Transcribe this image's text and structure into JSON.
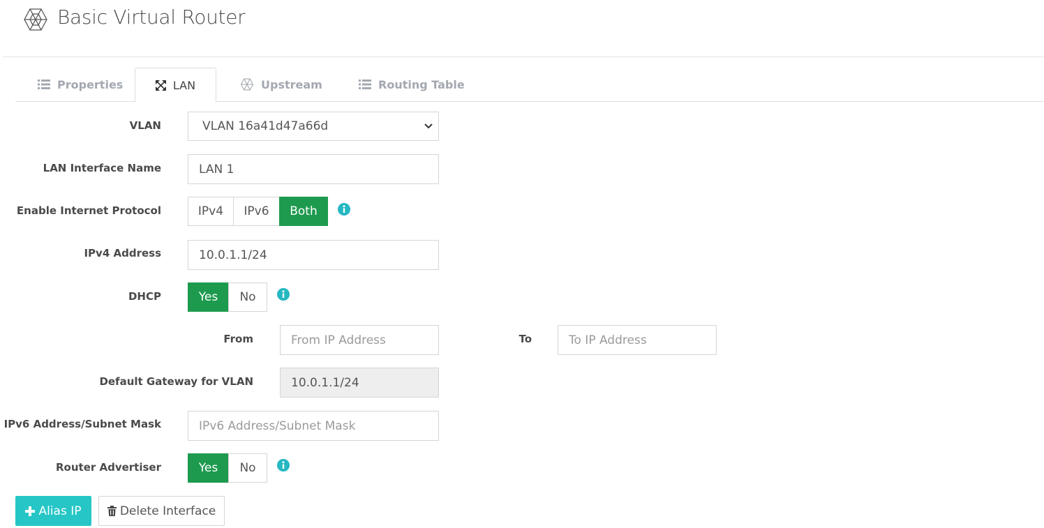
{
  "header": {
    "title": "Basic Virtual Router",
    "logo_icon": "hexagon-mesh-icon"
  },
  "tabs": [
    {
      "label": "Properties",
      "icon": "list-icon",
      "active": false
    },
    {
      "label": "LAN",
      "icon": "expand-arrows-icon",
      "active": true
    },
    {
      "label": "Upstream",
      "icon": "hexagon-mesh-icon",
      "active": false
    },
    {
      "label": "Routing Table",
      "icon": "list-icon",
      "active": false
    }
  ],
  "form": {
    "vlan": {
      "label": "VLAN",
      "value": "VLAN 16a41d47a66d"
    },
    "lan_name": {
      "label": "LAN Interface Name",
      "value": "LAN 1"
    },
    "protocol": {
      "label": "Enable Internet Protocol",
      "options": [
        "IPv4",
        "IPv6",
        "Both"
      ],
      "selected": "Both"
    },
    "ipv4": {
      "label": "IPv4 Address",
      "value": "10.0.1.1/24"
    },
    "dhcp": {
      "label": "DHCP",
      "options": [
        "Yes",
        "No"
      ],
      "selected": "Yes"
    },
    "from": {
      "label": "From",
      "placeholder": "From IP Address"
    },
    "to": {
      "label": "To",
      "placeholder": "To IP Address"
    },
    "gateway": {
      "label": "Default Gateway for VLAN",
      "value": "10.0.1.1/24"
    },
    "ipv6": {
      "label": "IPv6 Address/Subnet Mask",
      "placeholder": "IPv6 Address/Subnet Mask"
    },
    "router_adv": {
      "label": "Router Advertiser",
      "options": [
        "Yes",
        "No"
      ],
      "selected": "Yes"
    }
  },
  "actions": {
    "alias_ip": "Alias IP",
    "delete_interface": "Delete Interface"
  },
  "colors": {
    "accent_green": "#1e9a4f",
    "accent_teal": "#26c6c6",
    "info_icon": "#26b8c2"
  }
}
